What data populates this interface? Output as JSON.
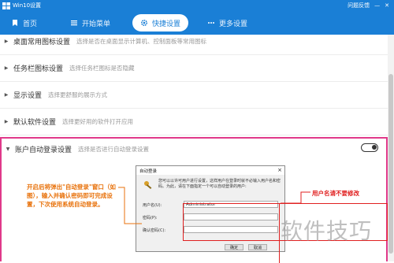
{
  "window": {
    "title": "Win10设置",
    "feedback": "问题反馈",
    "minimize": "—",
    "close": "✕"
  },
  "nav": [
    {
      "label": "首页",
      "icon": "bookmark-icon",
      "active": false
    },
    {
      "label": "开始菜单",
      "icon": "menu-icon",
      "active": false
    },
    {
      "label": "快捷设置",
      "icon": "gear-icon",
      "active": true
    },
    {
      "label": "更多设置",
      "icon": "more-icon",
      "active": false
    }
  ],
  "rows": [
    {
      "label": "桌面常用图标设置",
      "desc": "选择是否在桌面显示计算机、控制面板等常用图标"
    },
    {
      "label": "任务栏图标设置",
      "desc": "选择任务栏图标是否隐藏"
    },
    {
      "label": "显示设置",
      "desc": "选择更舒服的展示方式"
    },
    {
      "label": "默认软件设置",
      "desc": "选择更好用的软件打开应用"
    }
  ],
  "expanded": {
    "label": "账户自动登录设置",
    "desc": "选择是否进行自动登录设置"
  },
  "dialog": {
    "title": "自动登录",
    "text": "您可以以许可用户进行设置，这样用户在登录时就不必输入用户名和密码。为此，请在下面指定一个可以自动登录的用户:",
    "username_label": "用户名(U):",
    "username_value": "Administrator",
    "password_label": "密码(P):",
    "confirm_label": "确认密码(C):",
    "ok": "确定",
    "cancel": "取消"
  },
  "annotations": {
    "left": "开启后将弹出\"自动登录\"窗口（如图），输入并确认密码即可完成设置，下次使用系统自动登录。",
    "right": "用户名请不要修改"
  },
  "watermark": "软件技巧",
  "colors": {
    "accent": "#1a7fd6",
    "highlight_border": "#e0398a",
    "note_orange": "#e8720c",
    "note_red": "#e02020"
  }
}
